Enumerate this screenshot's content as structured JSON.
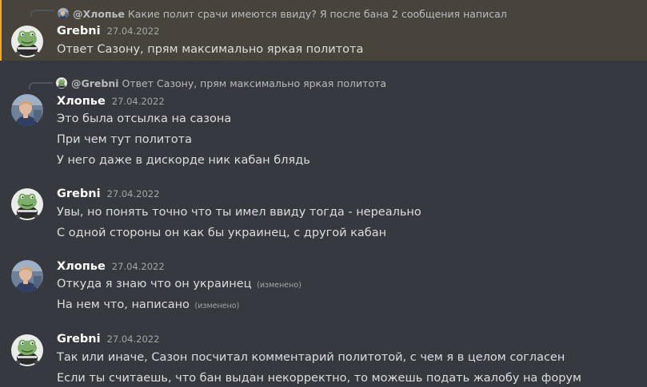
{
  "colors": {
    "background": "#36393f",
    "highlight_bar": "#faa81a",
    "author": "#ffffff",
    "text": "#dcddde",
    "muted": "#a3a6aa"
  },
  "messages": [
    {
      "author": "Grebni",
      "avatar": "frog-avatar",
      "timestamp": "27.04.2022",
      "highlighted": true,
      "reply": {
        "author": "@Хлопье",
        "text": "Какие полит срачи имеются ввиду? Я после бана 2 сообщения написал",
        "avatar": "human-avatar"
      },
      "lines": [
        {
          "text": "Ответ Сазону, прям максимально яркая политота",
          "edited": ""
        }
      ]
    },
    {
      "author": "Хлопье",
      "avatar": "human-avatar",
      "timestamp": "27.04.2022",
      "highlighted": false,
      "reply": {
        "author": "@Grebni",
        "text": "Ответ Сазону, прям максимально яркая политота",
        "avatar": "frog-avatar"
      },
      "lines": [
        {
          "text": "Это была отсылка на сазона",
          "edited": ""
        },
        {
          "text": "При чем тут политота",
          "edited": ""
        },
        {
          "text": "У него даже в дискорде ник кабан блядь",
          "edited": ""
        }
      ]
    },
    {
      "author": "Grebni",
      "avatar": "frog-avatar",
      "timestamp": "27.04.2022",
      "highlighted": false,
      "lines": [
        {
          "text": "Увы, но понять точно что ты имел ввиду тогда - нереально",
          "edited": ""
        },
        {
          "text": "С одной стороны он как бы украинец, с другой кабан",
          "edited": ""
        }
      ]
    },
    {
      "author": "Хлопье",
      "avatar": "human-avatar",
      "timestamp": "27.04.2022",
      "highlighted": false,
      "lines": [
        {
          "text": "Откуда я знаю что он украинец",
          "edited": "(изменено)"
        },
        {
          "text": "На нем что, написано",
          "edited": "(изменено)"
        }
      ]
    },
    {
      "author": "Grebni",
      "avatar": "frog-avatar",
      "timestamp": "27.04.2022",
      "highlighted": false,
      "lines": [
        {
          "text": "Так или иначе, Сазон посчитал комментарий политотой, с чем я в целом согласен",
          "edited": ""
        },
        {
          "text": "Если ты считаешь, что бан выдан некорректно, то можешь подать жалобу на форум",
          "edited": ""
        }
      ]
    }
  ]
}
